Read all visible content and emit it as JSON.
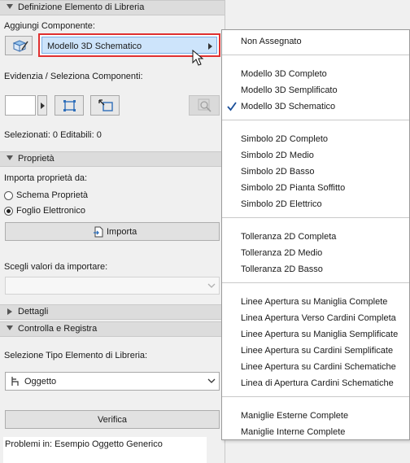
{
  "definizione": {
    "header": "Definizione Elemento di Libreria",
    "aggiungi_label": "Aggiungi Componente:",
    "dropdown_value": "Modello 3D Schematico",
    "evidenzia_label": "Evidenzia / Seleziona Componenti:",
    "status": "Selezionati: 0 Editabili: 0"
  },
  "proprieta": {
    "header": "Proprietà",
    "importa_da_label": "Importa proprietà da:",
    "option1": "Schema Proprietà",
    "option2": "Foglio Elettronico",
    "selected_option": "Foglio Elettronico",
    "importa_button": "Importa",
    "scegli_label": "Scegli valori da importare:"
  },
  "dettagli": {
    "header": "Dettagli"
  },
  "controlla": {
    "header": "Controlla e Registra",
    "tipo_label": "Selezione Tipo Elemento di Libreria:",
    "tipo_value": "Oggetto",
    "verifica_button": "Verifica",
    "problemi_text": "Problemi in: Esempio Oggetto Generico"
  },
  "menu": {
    "checked": "Modello 3D Schematico",
    "groups": [
      [
        "Non Assegnato"
      ],
      [
        "Modello 3D Completo",
        "Modello 3D Semplificato",
        "Modello 3D Schematico"
      ],
      [
        "Simbolo 2D Completo",
        "Simbolo 2D Medio",
        "Simbolo 2D Basso",
        "Simbolo 2D Pianta Soffitto",
        "Simbolo 2D Elettrico"
      ],
      [
        "Tolleranza 2D Completa",
        "Tolleranza 2D Medio",
        "Tolleranza 2D Basso"
      ],
      [
        "Linee Apertura su Maniglia Complete",
        "Linea Apertura Verso Cardini Completa",
        "Linee Apertura su Maniglia Semplificate",
        "Linee Apertura su Cardini Semplificate",
        "Linee Apertura su Cardini Schematiche",
        "Linea di Apertura Cardini Schematiche"
      ],
      [
        "Maniglie Esterne Complete",
        "Maniglie Interne Complete"
      ]
    ]
  }
}
